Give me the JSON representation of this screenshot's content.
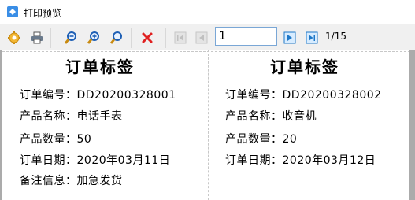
{
  "window": {
    "title": "打印预览"
  },
  "toolbar": {
    "buttons": [
      {
        "name": "settings-icon"
      },
      {
        "name": "print-icon"
      },
      {
        "name": "zoom-out-icon"
      },
      {
        "name": "zoom-in-icon"
      },
      {
        "name": "zoom-fit-icon"
      },
      {
        "name": "close-icon"
      },
      {
        "name": "first-page-icon"
      },
      {
        "name": "prev-page-icon"
      },
      {
        "name": "next-page-icon"
      },
      {
        "name": "last-page-icon"
      }
    ],
    "page_value": "1",
    "page_count": "1/15"
  },
  "labels": [
    {
      "title": "订单标签",
      "rows": [
        "订单编号：DD20200328001",
        "产品名称：电话手表",
        "产品数量：50",
        "订单日期：2020年03月11日",
        "备注信息：加急发货"
      ]
    },
    {
      "title": "订单标签",
      "rows": [
        "订单编号：DD20200328002",
        "产品名称：收音机",
        "产品数量：20",
        "订单日期：2020年03月12日"
      ]
    }
  ],
  "colors": {
    "accent": "#1e78c8",
    "close": "#e02020",
    "toolbar": "#f0f0f0",
    "preview_bg": "#ababab"
  }
}
